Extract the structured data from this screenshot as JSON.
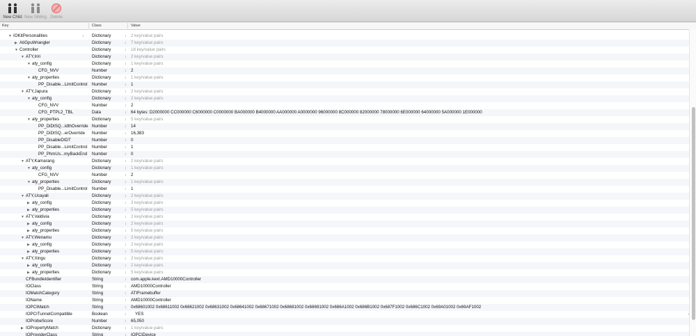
{
  "toolbar": {
    "new_child": "New Child",
    "new_sibling": "New Sibling",
    "delete": "Delete"
  },
  "columns": {
    "key": "Key",
    "class": "Class",
    "value": "Value"
  },
  "rows": [
    {
      "key": "IOKitPersonalities",
      "class": "Dictionary",
      "value": "2 key/value pairs",
      "indent": 0,
      "tri": "open",
      "gray": true,
      "stepKey": true
    },
    {
      "key": "AtiGpuWrangler",
      "class": "Dictionary",
      "value": "7 key/value pairs",
      "indent": 1,
      "tri": "closed",
      "gray": true
    },
    {
      "key": "Controller",
      "class": "Dictionary",
      "value": "18 key/value pairs",
      "indent": 1,
      "tri": "open",
      "gray": true
    },
    {
      "key": "ATY,Iriri",
      "class": "Dictionary",
      "value": "2 key/value pairs",
      "indent": 2,
      "tri": "open",
      "gray": true
    },
    {
      "key": "aty_config",
      "class": "Dictionary",
      "value": "1 key/value pairs",
      "indent": 3,
      "tri": "open",
      "gray": true
    },
    {
      "key": "CFG_NVV",
      "class": "Number",
      "value": "2",
      "indent": 4,
      "tri": "none"
    },
    {
      "key": "aty_properties",
      "class": "Dictionary",
      "value": "1 key/value pairs",
      "indent": 3,
      "tri": "open",
      "gray": true
    },
    {
      "key": "PP_Disable...LimitControl",
      "class": "Number",
      "value": "1",
      "indent": 4,
      "tri": "none"
    },
    {
      "key": "ATY,Japura",
      "class": "Dictionary",
      "value": "2 key/value pairs",
      "indent": 2,
      "tri": "open",
      "gray": true
    },
    {
      "key": "aty_config",
      "class": "Dictionary",
      "value": "2 key/value pairs",
      "indent": 3,
      "tri": "open",
      "gray": true
    },
    {
      "key": "CFG_NVV",
      "class": "Number",
      "value": "2",
      "indent": 4,
      "tri": "none"
    },
    {
      "key": "CFG_PTPL2_TBL",
      "class": "Data",
      "value": "64 bytes: D2000000 CC000000 C6000000 C0000000 BA000000 B4000000 AA000000 A0000000 96000000 8C000000 82000000 78000000 6E000000 64000000 5A000000 1E000000",
      "indent": 4,
      "tri": "none"
    },
    {
      "key": "aty_properties",
      "class": "Dictionary",
      "value": "5 key/value pairs",
      "indent": 3,
      "tri": "open",
      "gray": true
    },
    {
      "key": "PP_DiDtSQ...idthOverride",
      "class": "Number",
      "value": "14",
      "indent": 4,
      "tri": "none"
    },
    {
      "key": "PP_DiDtSQ...erOverride",
      "class": "Number",
      "value": "16,383",
      "indent": 4,
      "tri": "none"
    },
    {
      "key": "PP_DisableDIDT",
      "class": "Number",
      "value": "0",
      "indent": 4,
      "tri": "none"
    },
    {
      "key": "PP_Disable...LimitControl",
      "class": "Number",
      "value": "1",
      "indent": 4,
      "tri": "none"
    },
    {
      "key": "PP_PhmUs...myBackEnd",
      "class": "Number",
      "value": "0",
      "indent": 4,
      "tri": "none"
    },
    {
      "key": "ATY,Kamarang",
      "class": "Dictionary",
      "value": "2 key/value pairs",
      "indent": 2,
      "tri": "open",
      "gray": true
    },
    {
      "key": "aty_config",
      "class": "Dictionary",
      "value": "1 key/value pairs",
      "indent": 3,
      "tri": "open",
      "gray": true
    },
    {
      "key": "CFG_NVV",
      "class": "Number",
      "value": "2",
      "indent": 4,
      "tri": "none"
    },
    {
      "key": "aty_properties",
      "class": "Dictionary",
      "value": "1 key/value pairs",
      "indent": 3,
      "tri": "open",
      "gray": true
    },
    {
      "key": "PP_Disable...LimitControl",
      "class": "Number",
      "value": "1",
      "indent": 4,
      "tri": "none"
    },
    {
      "key": "ATY,Ucayali",
      "class": "Dictionary",
      "value": "2 key/value pairs",
      "indent": 2,
      "tri": "open",
      "gray": true
    },
    {
      "key": "aty_config",
      "class": "Dictionary",
      "value": "3 key/value pairs",
      "indent": 3,
      "tri": "closed",
      "gray": true
    },
    {
      "key": "aty_properties",
      "class": "Dictionary",
      "value": "5 key/value pairs",
      "indent": 3,
      "tri": "closed",
      "gray": true
    },
    {
      "key": "ATY,Valdivia",
      "class": "Dictionary",
      "value": "2 key/value pairs",
      "indent": 2,
      "tri": "open",
      "gray": true
    },
    {
      "key": "aty_config",
      "class": "Dictionary",
      "value": "2 key/value pairs",
      "indent": 3,
      "tri": "closed",
      "gray": true
    },
    {
      "key": "aty_properties",
      "class": "Dictionary",
      "value": "5 key/value pairs",
      "indent": 3,
      "tri": "closed",
      "gray": true
    },
    {
      "key": "ATY,Wenamu",
      "class": "Dictionary",
      "value": "2 key/value pairs",
      "indent": 2,
      "tri": "open",
      "gray": true
    },
    {
      "key": "aty_config",
      "class": "Dictionary",
      "value": "2 key/value pairs",
      "indent": 3,
      "tri": "closed",
      "gray": true
    },
    {
      "key": "aty_properties",
      "class": "Dictionary",
      "value": "5 key/value pairs",
      "indent": 3,
      "tri": "closed",
      "gray": true
    },
    {
      "key": "ATY,Xingu",
      "class": "Dictionary",
      "value": "2 key/value pairs",
      "indent": 2,
      "tri": "open",
      "gray": true
    },
    {
      "key": "aty_config",
      "class": "Dictionary",
      "value": "2 key/value pairs",
      "indent": 3,
      "tri": "closed",
      "gray": true
    },
    {
      "key": "aty_properties",
      "class": "Dictionary",
      "value": "5 key/value pairs",
      "indent": 3,
      "tri": "closed",
      "gray": true
    },
    {
      "key": "CFBundleIdentifier",
      "class": "String",
      "value": "com.apple.kext.AMD10000Controller",
      "indent": 2,
      "tri": "none"
    },
    {
      "key": "IOClass",
      "class": "String",
      "value": "AMD10000Controller",
      "indent": 2,
      "tri": "none"
    },
    {
      "key": "IOMatchCategory",
      "class": "String",
      "value": "ATIFramebuffer",
      "indent": 2,
      "tri": "none"
    },
    {
      "key": "IOName",
      "class": "String",
      "value": "AMD10000Controller",
      "indent": 2,
      "tri": "none"
    },
    {
      "key": "IOPCIMatch",
      "class": "String",
      "value": "0x68601002 0x68611002 0x68621002 0x68631002 0x68641002 0x68671002 0x68681002 0x68691002 0x686A1002 0x686B1002 0x687F1002 0x686C1002 0x69A01002 0x69AF1002",
      "indent": 2,
      "tri": "none"
    },
    {
      "key": "IOPCITunnelCompatible",
      "class": "Boolean",
      "value": "YES",
      "indent": 2,
      "tri": "none",
      "bool": true
    },
    {
      "key": "IOProbeScore",
      "class": "Number",
      "value": "65,050",
      "indent": 2,
      "tri": "none"
    },
    {
      "key": "IOPropertyMatch",
      "class": "Dictionary",
      "value": "1 key/value pairs",
      "indent": 2,
      "tri": "closed",
      "gray": true
    },
    {
      "key": "IOProviderClass",
      "class": "String",
      "value": "IOPCIDevice",
      "indent": 2,
      "tri": "none"
    }
  ]
}
